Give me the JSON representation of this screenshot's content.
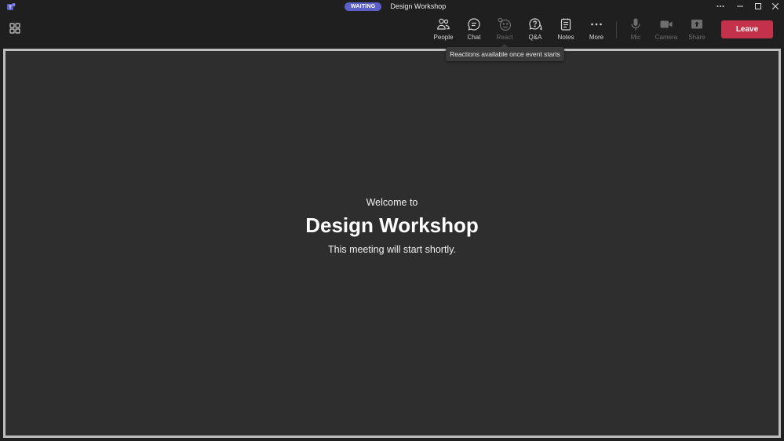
{
  "window": {
    "status_badge": "WAITING",
    "title": "Design Workshop",
    "controls": [
      "more-options",
      "minimize",
      "maximize",
      "close"
    ]
  },
  "toolbar": {
    "tools": [
      {
        "id": "people",
        "label": "People",
        "icon": "people-icon",
        "enabled": true
      },
      {
        "id": "chat",
        "label": "Chat",
        "icon": "chat-icon",
        "enabled": true
      },
      {
        "id": "react",
        "label": "React",
        "icon": "emoji-icon",
        "enabled": false
      },
      {
        "id": "qa",
        "label": "Q&A",
        "icon": "qa-icon",
        "enabled": true
      },
      {
        "id": "notes",
        "label": "Notes",
        "icon": "notes-icon",
        "enabled": true
      },
      {
        "id": "more",
        "label": "More",
        "icon": "ellipsis-icon",
        "enabled": true
      },
      {
        "id": "mic",
        "label": "Mic",
        "icon": "mic-icon",
        "enabled": false
      },
      {
        "id": "camera",
        "label": "Camera",
        "icon": "camera-icon",
        "enabled": false
      },
      {
        "id": "share",
        "label": "Share",
        "icon": "share-icon",
        "enabled": false
      }
    ],
    "leave_label": "Leave",
    "react_tooltip": "Reactions available once event starts"
  },
  "stage": {
    "welcome_line": "Welcome to",
    "event_title": "Design Workshop",
    "subtitle": "This meeting will start shortly."
  },
  "colors": {
    "background": "#1f1f1f",
    "stage": "#2e2e2e",
    "stage_border": "#bdbdbd",
    "leave": "#c4314b",
    "badge": "#5b5fc7"
  }
}
